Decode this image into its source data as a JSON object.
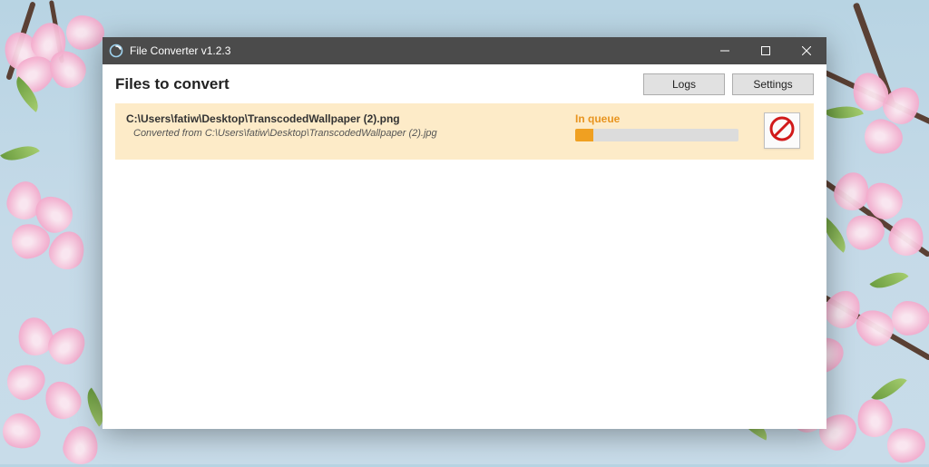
{
  "titlebar": {
    "title": "File Converter v1.2.3"
  },
  "header": {
    "title": "Files to convert",
    "logs_button": "Logs",
    "settings_button": "Settings"
  },
  "file": {
    "output_path": "C:\\Users\\fatiw\\Desktop\\TranscodedWallpaper (2).png",
    "converted_from_prefix": "Converted from ",
    "source_path": "C:\\Users\\fatiw\\Desktop\\TranscodedWallpaper (2).jpg",
    "status": "In queue",
    "progress_percent": 11
  }
}
